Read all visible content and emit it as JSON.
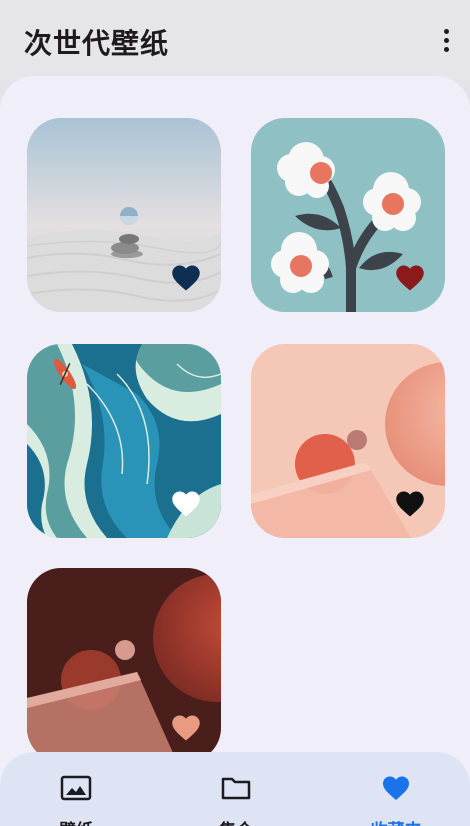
{
  "app_bar": {
    "title": "次世代壁纸",
    "more_icon": "more-vert-icon"
  },
  "favorites": [
    {
      "name": "desert-balance",
      "favorited": true,
      "heart_color": "#0f2f52"
    },
    {
      "name": "flower-branch",
      "favorited": true,
      "heart_color": "#8b1a1a"
    },
    {
      "name": "kayak-waves",
      "favorited": true,
      "heart_color": "#ffffff"
    },
    {
      "name": "peach-orbs",
      "favorited": true,
      "heart_color": "#111111"
    },
    {
      "name": "dark-orbs",
      "favorited": true,
      "heart_color": "#e89a82"
    }
  ],
  "bottom_nav": {
    "items": [
      {
        "label": "壁纸",
        "icon": "image-icon",
        "active": false
      },
      {
        "label": "集合",
        "icon": "folder-icon",
        "active": false
      },
      {
        "label": "收藏夹",
        "icon": "heart-icon",
        "active": true
      }
    ],
    "active_color": "#1a73e8"
  }
}
